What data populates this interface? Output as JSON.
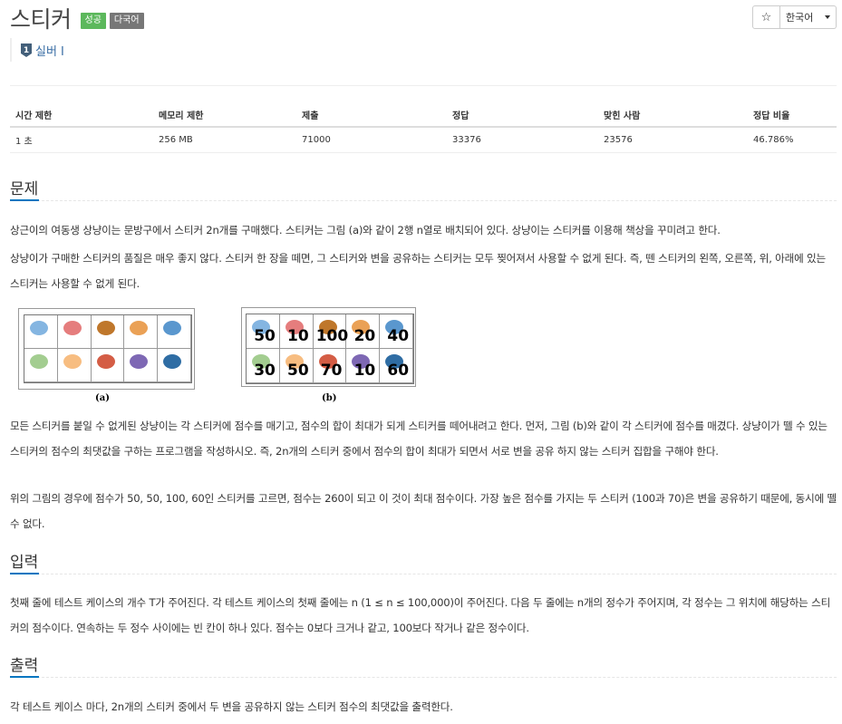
{
  "problem": {
    "title": "스티커",
    "badges": [
      {
        "label": "성공",
        "color": "#5cb85c"
      },
      {
        "label": "다국어",
        "color": "#777777"
      }
    ],
    "tier": {
      "label": "실버 I",
      "number": "1"
    }
  },
  "toolbar": {
    "star": "☆",
    "language": "한국어"
  },
  "info_table": {
    "headers": [
      "시간 제한",
      "메모리 제한",
      "제출",
      "정답",
      "맞힌 사람",
      "정답 비율"
    ],
    "row": [
      "1 초",
      "256 MB",
      "71000",
      "33376",
      "23576",
      "46.786%"
    ]
  },
  "sections": {
    "problem": {
      "heading": "문제",
      "paragraphs": [
        "상근이의 여동생 상냥이는 문방구에서 스티커 2n개를 구매했다. 스티커는 그림 (a)와 같이 2행 n열로 배치되어 있다. 상냥이는 스티커를 이용해 책상을 꾸미려고 한다.",
        "상냥이가 구매한 스티커의 품질은 매우 좋지 않다. 스티커 한 장을 떼면, 그 스티커와 변을 공유하는 스티커는 모두 찢어져서 사용할 수 없게 된다. 즉, 뗀 스티커의 왼쪽, 오른쪽, 위, 아래에 있는 스티커는 사용할 수 없게 된다.",
        "모든 스티커를 붙일 수 없게된 상냥이는 각 스티커에 점수를 매기고, 점수의 합이 최대가 되게 스티커를 떼어내려고 한다. 먼저, 그림 (b)와 같이 각 스티커에 점수를 매겼다. 상냥이가 뗄 수 있는 스티커의 점수의 최댓값을 구하는 프로그램을 작성하시오. 즉, 2n개의 스티커 중에서 점수의 합이 최대가 되면서 서로 변을 공유 하지 않는 스티커 집합을 구해야 한다.",
        "위의 그림의 경우에 점수가 50, 50, 100, 60인 스티커를 고르면, 점수는 260이 되고 이 것이 최대 점수이다. 가장 높은 점수를 가지는 두 스티커 (100과 70)은 변을 공유하기 때문에, 동시에 뗄 수 없다."
      ]
    },
    "input": {
      "heading": "입력",
      "paragraphs": [
        "첫째 줄에 테스트 케이스의 개수 T가 주어진다. 각 테스트 케이스의 첫째 줄에는 n (1 ≤ n ≤ 100,000)이 주어진다. 다음 두 줄에는 n개의 정수가 주어지며, 각 정수는 그 위치에 해당하는 스티커의 점수이다. 연속하는 두 정수 사이에는 빈 칸이 하나 있다. 점수는 0보다 크거나 같고, 100보다 작거나 같은 정수이다."
      ]
    },
    "output": {
      "heading": "출력",
      "paragraphs": [
        "각 테스트 케이스 마다, 2n개의 스티커 중에서 두 변을 공유하지 않는 스티커 점수의 최댓값을 출력한다."
      ]
    }
  },
  "figures": {
    "a": {
      "caption": "(a)"
    },
    "b": {
      "caption": "(b)",
      "scores": [
        [
          "50",
          "10",
          "100",
          "20",
          "40"
        ],
        [
          "30",
          "50",
          "70",
          "10",
          "60"
        ]
      ]
    }
  },
  "sticker_colors": [
    "#6fa8dc",
    "#e06666",
    "#b45f06",
    "#e69138",
    "#3d85c6",
    "#93c47d",
    "#f6b26b",
    "#cc4125",
    "#674ea7",
    "#0b5394"
  ]
}
